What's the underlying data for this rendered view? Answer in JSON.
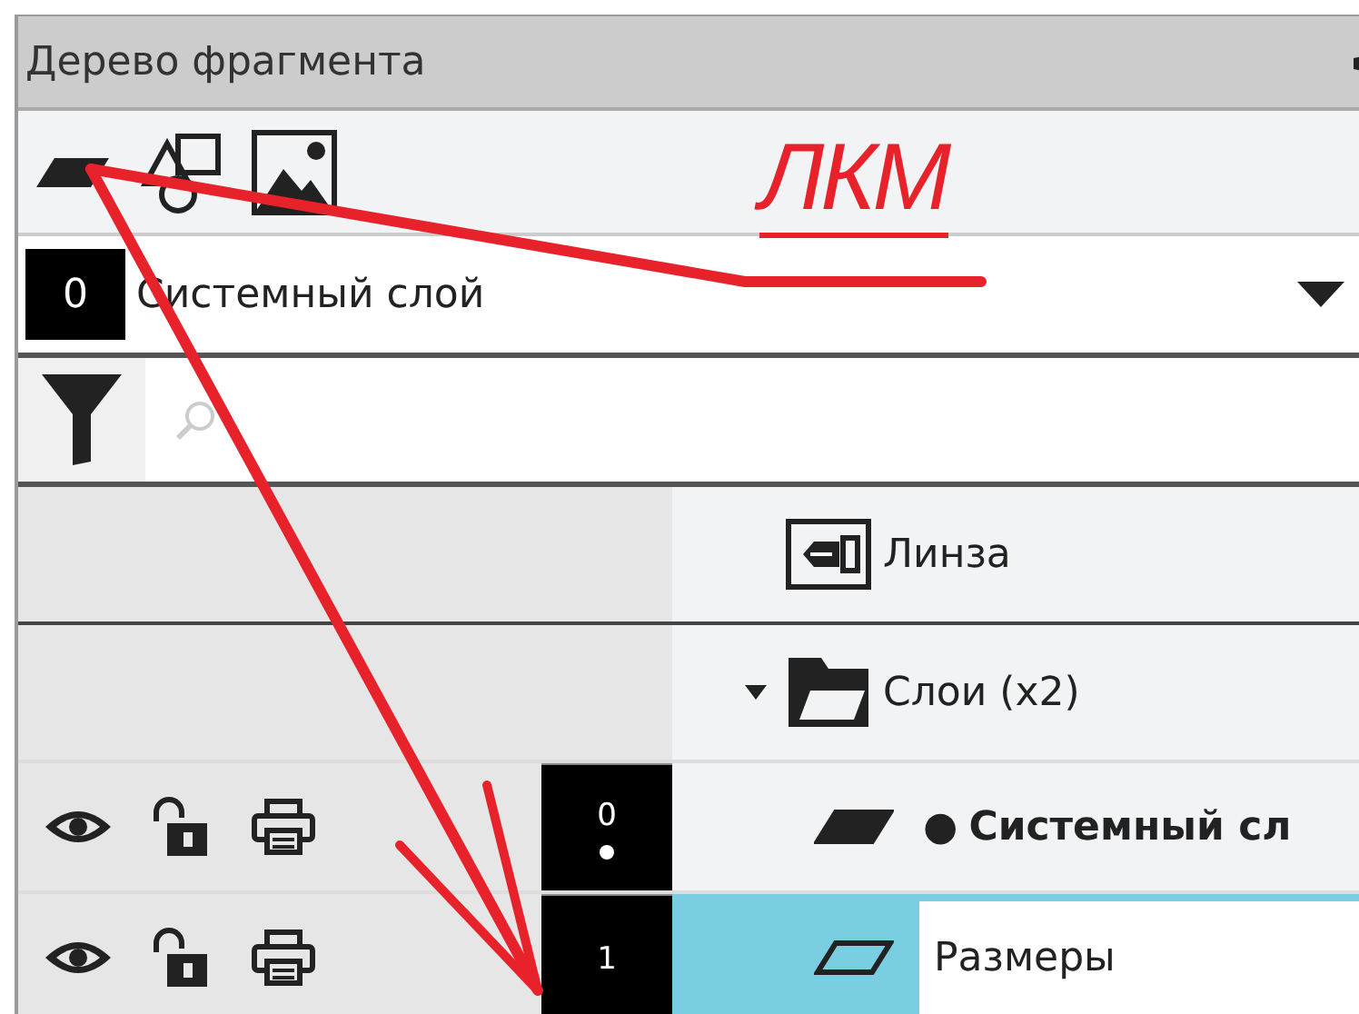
{
  "panel": {
    "title": "Дерево фрагмента"
  },
  "toolbar": [
    {
      "kind": "layer"
    },
    {
      "kind": "shapes"
    },
    {
      "kind": "image"
    }
  ],
  "layer_select": {
    "number": "0",
    "value": "Системный слой"
  },
  "filter": {
    "active": true
  },
  "tree": [
    {
      "kind": "view",
      "label": "Линза"
    },
    {
      "kind": "folder",
      "label": "Слои (x2)",
      "expanded": true,
      "children": [
        {
          "kind": "layer",
          "number": "0",
          "bullet": "●",
          "label": "Системный сл",
          "current": true,
          "visible": true,
          "locked": false,
          "printable": true,
          "selected": false,
          "editing": false
        },
        {
          "kind": "layer",
          "number": "1",
          "label": "Размеры",
          "current": false,
          "visible": true,
          "locked": false,
          "printable": true,
          "selected": true,
          "editing": true
        }
      ]
    }
  ],
  "annotation": {
    "label": "ЛКМ"
  }
}
